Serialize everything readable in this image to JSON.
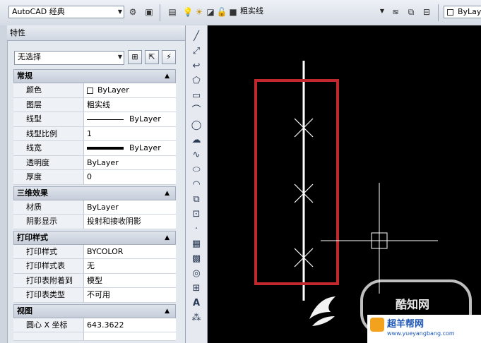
{
  "toolbar": {
    "workspace": "AutoCAD 经典",
    "layer": "粗实线",
    "color": "ByLaye"
  },
  "palette": {
    "title": "特性",
    "selection": "无选择"
  },
  "sections": {
    "general": {
      "title": "常规",
      "rows": [
        {
          "key": "颜色",
          "value": "ByLayer"
        },
        {
          "key": "图层",
          "value": "粗实线"
        },
        {
          "key": "线型",
          "value": "ByLayer"
        },
        {
          "key": "线型比例",
          "value": "1"
        },
        {
          "key": "线宽",
          "value": "ByLayer"
        },
        {
          "key": "透明度",
          "value": "ByLayer"
        },
        {
          "key": "厚度",
          "value": "0"
        }
      ]
    },
    "effects3d": {
      "title": "三维效果",
      "rows": [
        {
          "key": "材质",
          "value": "ByLayer"
        },
        {
          "key": "阴影显示",
          "value": "投射和接收阴影"
        }
      ]
    },
    "plot": {
      "title": "打印样式",
      "rows": [
        {
          "key": "打印样式",
          "value": "BYCOLOR"
        },
        {
          "key": "打印样式表",
          "value": "无"
        },
        {
          "key": "打印表附着到",
          "value": "模型"
        },
        {
          "key": "打印表类型",
          "value": "不可用"
        }
      ]
    },
    "view": {
      "title": "视图",
      "rows": [
        {
          "key": "圆心 X 坐标",
          "value": "643.3622"
        }
      ]
    }
  },
  "watermark": {
    "text1": "酷知网",
    "text2": "超羊帮网",
    "url": "www.yueyangbang.com"
  },
  "colors": {
    "highlight_rect": "#c0282d",
    "canvas_bg": "#000000"
  }
}
